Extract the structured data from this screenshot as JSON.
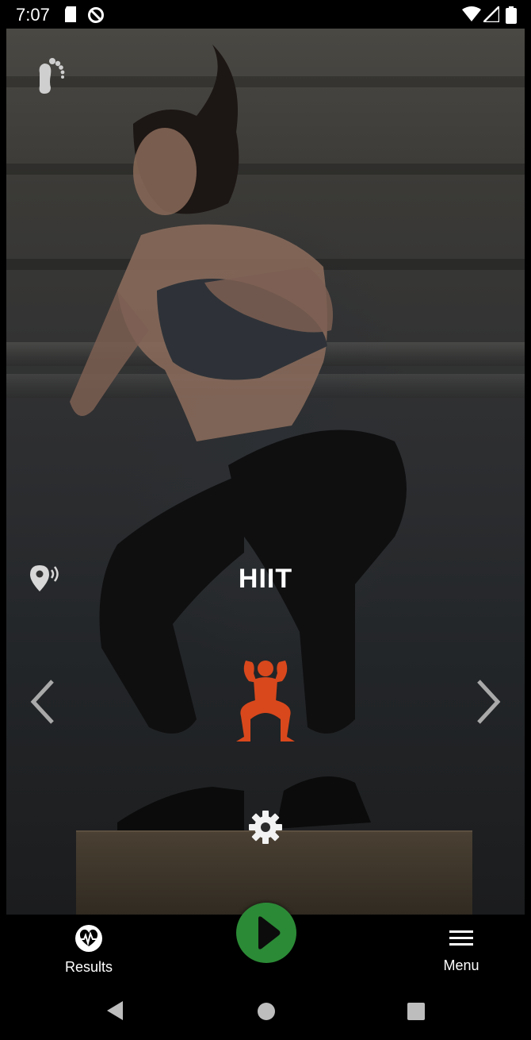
{
  "status_bar": {
    "time": "7:07"
  },
  "workout": {
    "title": "HIIT"
  },
  "bottom_nav": {
    "results_label": "Results",
    "menu_label": "Menu"
  },
  "icons": {
    "app_logo": "footprint-icon",
    "location": "location-broadcast-icon",
    "prev": "chevron-left-icon",
    "next": "chevron-right-icon",
    "workout_type": "squat-figure-icon",
    "settings": "gear-icon",
    "play": "play-icon",
    "results": "heart-pulse-icon",
    "menu": "hamburger-icon"
  },
  "colors": {
    "accent_play": "#2b8a36",
    "workout_icon": "#d9481c"
  }
}
